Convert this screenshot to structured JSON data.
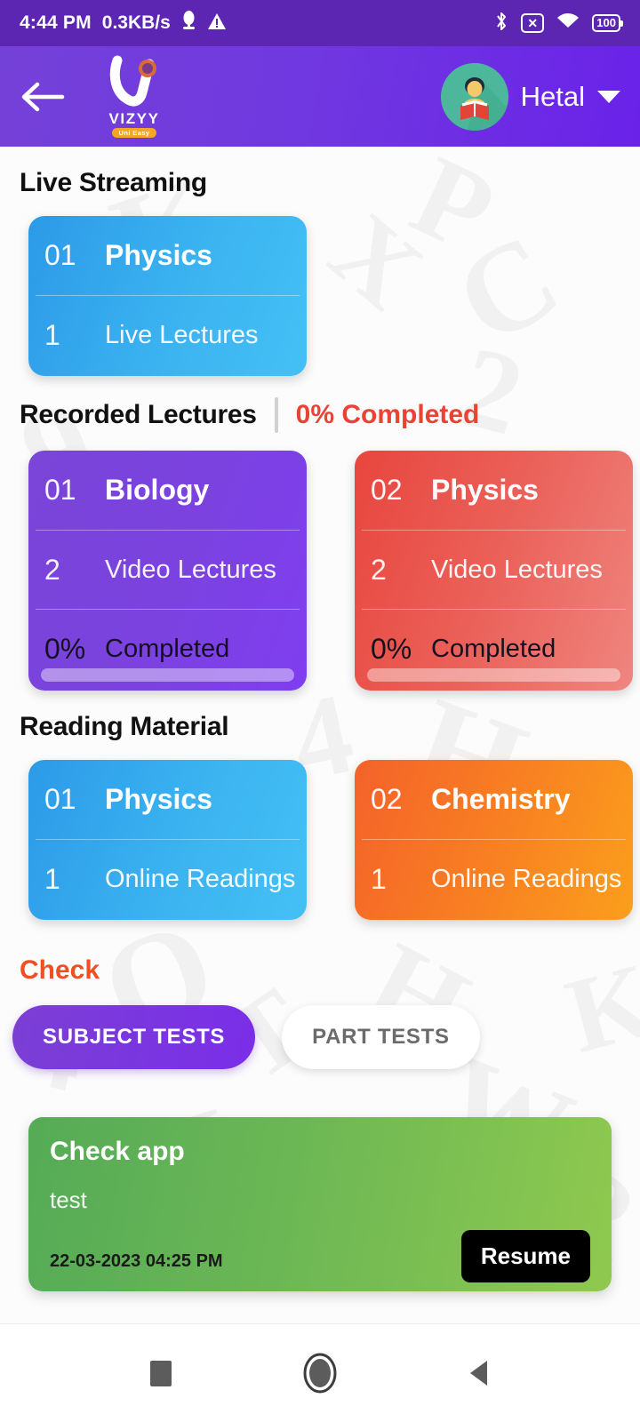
{
  "status_bar": {
    "time": "4:44 PM",
    "network_speed": "0.3KB/s",
    "icons": [
      "mic-icon",
      "warning-icon",
      "bluetooth-icon",
      "no-sim-icon",
      "wifi-icon"
    ],
    "battery_level": "100"
  },
  "app_bar": {
    "back_label": "←",
    "logo_text": "VIZYY",
    "logo_badge": "Uni Easy",
    "profile_name": "Hetal"
  },
  "sections": {
    "live_streaming": {
      "title": "Live Streaming",
      "cards": [
        {
          "number": "01",
          "subject": "Physics",
          "count": "1",
          "count_label": "Live Lectures",
          "color": "#3bb3f0"
        }
      ]
    },
    "recorded_lectures": {
      "title": "Recorded Lectures",
      "completion": "0% Completed",
      "cards": [
        {
          "number": "01",
          "subject": "Biology",
          "count": "2",
          "count_label": "Video Lectures",
          "percent": "0%",
          "percent_label": "Completed",
          "color": "#7b42e0"
        },
        {
          "number": "02",
          "subject": "Physics",
          "count": "2",
          "count_label": "Video Lectures",
          "percent": "0%",
          "percent_label": "Completed",
          "color": "#ea6159"
        }
      ]
    },
    "reading_material": {
      "title": "Reading Material",
      "cards": [
        {
          "number": "01",
          "subject": "Physics",
          "count": "1",
          "count_label": "Online Readings",
          "color": "#3bb3f0"
        },
        {
          "number": "02",
          "subject": "Chemistry",
          "count": "1",
          "count_label": "Online Readings",
          "color": "#f87f22"
        }
      ]
    },
    "check": {
      "title": "Check",
      "tabs": [
        {
          "label": "SUBJECT TESTS",
          "selected": true
        },
        {
          "label": "PART TESTS",
          "selected": false
        }
      ],
      "test_card": {
        "title": "Check app",
        "subtitle": "test",
        "datetime": "22-03-2023 04:25 PM",
        "action_label": "Resume"
      }
    }
  },
  "nav_bar": {
    "recents": "square-icon",
    "home": "circle-icon",
    "back": "triangle-back-icon"
  },
  "colors": {
    "brand_purple": "#7038e0",
    "status_bar": "#5c26b3",
    "accent_red": "#ea4335",
    "accent_orange": "#f04f23",
    "green": "#6cb755"
  },
  "watermarks": [
    "P",
    "C",
    "X",
    "2",
    "4",
    "H",
    "a",
    "K",
    "T",
    "W",
    "Q",
    "N",
    "J",
    "9",
    "R"
  ]
}
